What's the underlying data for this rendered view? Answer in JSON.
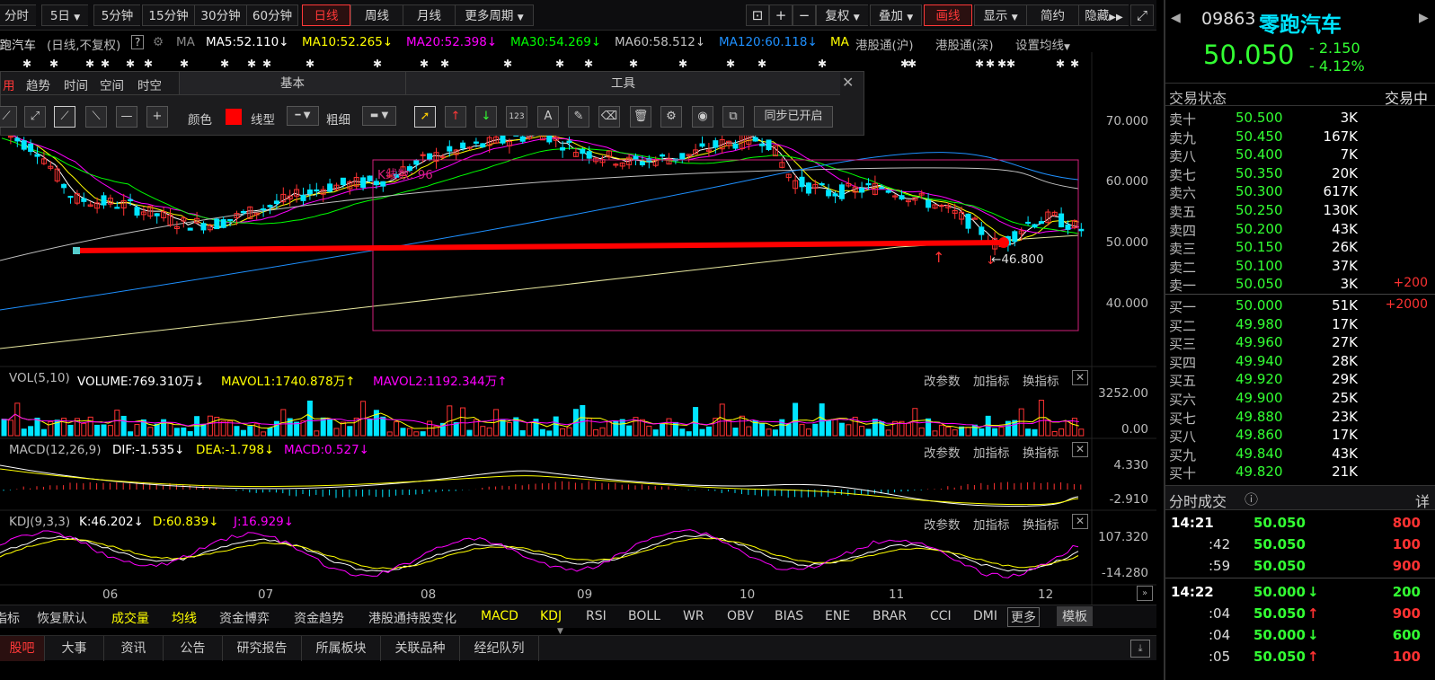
{
  "toolbar": {
    "periods": [
      "分时",
      "5日",
      "5分钟",
      "15分钟",
      "30分钟",
      "60分钟",
      "日线",
      "周线",
      "月线",
      "更多周期"
    ],
    "active_period": "日线",
    "right_buttons": [
      "复权",
      "叠加",
      "画线",
      "显示",
      "简约",
      "隐藏"
    ],
    "active_right": "画线"
  },
  "indicator_line": {
    "name": "零跑汽车",
    "mode": "(日线,不复权)",
    "help": "?",
    "ma_label": "MA",
    "ma5": "MA5:52.110",
    "ma10": "MA10:52.265",
    "ma20": "MA20:52.398",
    "ma30": "MA30:54.269",
    "ma60": "MA60:58.512",
    "ma120": "MA120:60.118",
    "ma_more": "MA",
    "hk_sh": "港股通(沪)",
    "hk_sz": "港股通(深)",
    "settings": "设置均线"
  },
  "tool_panel": {
    "tabs": [
      "用",
      "趋势",
      "时间",
      "空间",
      "时空"
    ],
    "basic_header": "基本",
    "tools_header": "工具",
    "color_label": "颜色",
    "line_type_label": "线型",
    "thickness_label": "粗细",
    "sync_label": "同步已开启",
    "count_btn": "123"
  },
  "price_axis": [
    "70.000",
    "60.000",
    "50.000",
    "40.000"
  ],
  "annotations": {
    "kline_count": "K线数: 96",
    "low_price": "46.800"
  },
  "volume": {
    "title": "VOL(5,10)",
    "volume": "VOLUME:769.310万",
    "mavol1": "MAVOL1:1740.878万",
    "mavol2": "MAVOL2:1192.344万",
    "axis_top": "3252.00",
    "axis_bottom": "0.00"
  },
  "macd": {
    "title": "MACD(12,26,9)",
    "dif": "DIF:-1.535",
    "dea": "DEA:-1.798",
    "macd": "MACD:0.527",
    "axis_top": "4.330",
    "axis_bottom": "-2.910"
  },
  "kdj": {
    "title": "KDJ(9,3,3)",
    "k": "K:46.202",
    "d": "D:60.839",
    "j": "J:16.929",
    "axis_top": "107.320",
    "axis_bottom": "-14.280"
  },
  "panel_tools": {
    "params": "改参数",
    "add": "加指标",
    "swap": "换指标"
  },
  "x_axis_months": [
    "06",
    "07",
    "08",
    "09",
    "10",
    "11",
    "12"
  ],
  "indicator_tabs": [
    "指标",
    "恢复默认",
    "成交量",
    "均线",
    "资金博弈",
    "资金趋势",
    "港股通持股变化",
    "MACD",
    "KDJ",
    "RSI",
    "BOLL",
    "WR",
    "OBV",
    "BIAS",
    "ENE",
    "BRAR",
    "CCI",
    "DMI",
    "更多",
    "模板"
  ],
  "info_tabs": [
    "股吧",
    "大事",
    "资讯",
    "公告",
    "研究报告",
    "所属板块",
    "关联品种",
    "经纪队列"
  ],
  "quote": {
    "code": "09863",
    "name": "零跑汽车",
    "price": "50.050",
    "change": "- 2.150",
    "change_pct": "- 4.12%",
    "status_label": "交易状态",
    "status_value": "交易中",
    "asks": [
      {
        "label": "卖十",
        "price": "50.500",
        "vol": "3K",
        "delta": ""
      },
      {
        "label": "卖九",
        "price": "50.450",
        "vol": "167K",
        "delta": ""
      },
      {
        "label": "卖八",
        "price": "50.400",
        "vol": "7K",
        "delta": ""
      },
      {
        "label": "卖七",
        "price": "50.350",
        "vol": "20K",
        "delta": ""
      },
      {
        "label": "卖六",
        "price": "50.300",
        "vol": "617K",
        "delta": ""
      },
      {
        "label": "卖五",
        "price": "50.250",
        "vol": "130K",
        "delta": ""
      },
      {
        "label": "卖四",
        "price": "50.200",
        "vol": "43K",
        "delta": ""
      },
      {
        "label": "卖三",
        "price": "50.150",
        "vol": "26K",
        "delta": ""
      },
      {
        "label": "卖二",
        "price": "50.100",
        "vol": "37K",
        "delta": ""
      },
      {
        "label": "卖一",
        "price": "50.050",
        "vol": "3K",
        "delta": "+200"
      }
    ],
    "bids": [
      {
        "label": "买一",
        "price": "50.000",
        "vol": "51K",
        "delta": "+2000"
      },
      {
        "label": "买二",
        "price": "49.980",
        "vol": "17K",
        "delta": ""
      },
      {
        "label": "买三",
        "price": "49.960",
        "vol": "27K",
        "delta": ""
      },
      {
        "label": "买四",
        "price": "49.940",
        "vol": "28K",
        "delta": ""
      },
      {
        "label": "买五",
        "price": "49.920",
        "vol": "29K",
        "delta": ""
      },
      {
        "label": "买六",
        "price": "49.900",
        "vol": "25K",
        "delta": ""
      },
      {
        "label": "买七",
        "price": "49.880",
        "vol": "23K",
        "delta": ""
      },
      {
        "label": "买八",
        "price": "49.860",
        "vol": "17K",
        "delta": ""
      },
      {
        "label": "买九",
        "price": "49.840",
        "vol": "43K",
        "delta": ""
      },
      {
        "label": "买十",
        "price": "49.820",
        "vol": "21K",
        "delta": ""
      }
    ],
    "trades_title": "分时成交",
    "trades_detail": "详",
    "trades": [
      {
        "time": "14:21",
        "price": "50.050",
        "arrow": "",
        "vol": "800"
      },
      {
        "time": ":42",
        "price": "50.050",
        "arrow": "",
        "vol": "100"
      },
      {
        "time": ":59",
        "price": "50.050",
        "arrow": "",
        "vol": "900"
      },
      {
        "time": "14:22",
        "price": "50.000",
        "arrow": "↓",
        "vol": "200"
      },
      {
        "time": ":04",
        "price": "50.050",
        "arrow": "↑",
        "vol": "900"
      },
      {
        "time": ":04",
        "price": "50.000",
        "arrow": "↓",
        "vol": "600"
      },
      {
        "time": ":05",
        "price": "50.050",
        "arrow": "↑",
        "vol": "100"
      }
    ]
  },
  "colors": {
    "up": "#ff3232",
    "down": "#00e5ff",
    "ma5": "#ffffff",
    "ma10": "#ffff00",
    "ma20": "#ff00ff",
    "ma30": "#00ff00",
    "ma60": "#c0c0c0",
    "ma120": "#1e90ff",
    "green_price": "#33ff33"
  }
}
